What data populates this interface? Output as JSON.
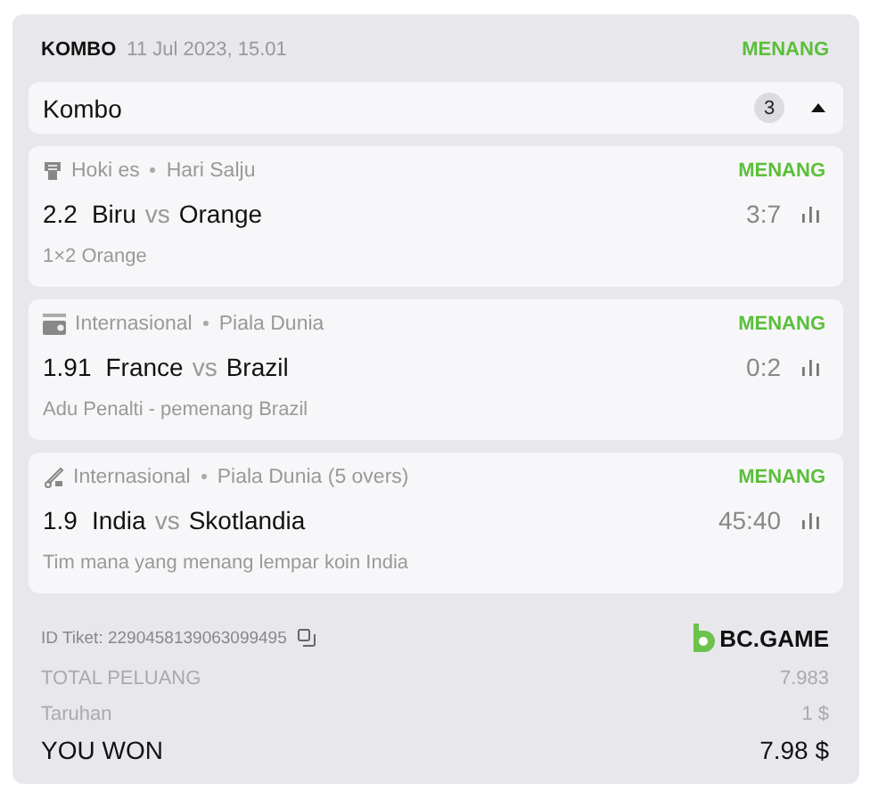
{
  "header": {
    "type": "KOMBO",
    "date": "11 Jul 2023, 15.01",
    "status": "MENANG"
  },
  "combo": {
    "label": "Kombo",
    "count": "3",
    "expanded": true
  },
  "bets": [
    {
      "kind": "hockey",
      "league": "Hoki es",
      "event": "Hari Salju",
      "status": "MENANG",
      "odds": "2.2",
      "home": "Biru",
      "vs": "vs",
      "away": "Orange",
      "score": "3:7",
      "market": "1×2 Orange"
    },
    {
      "kind": "fifa",
      "league": "Internasional",
      "event": "Piala Dunia",
      "status": "MENANG",
      "odds": "1.91",
      "home": "France",
      "vs": "vs",
      "away": "Brazil",
      "score": "0:2",
      "market": "Adu Penalti - pemenang Brazil"
    },
    {
      "kind": "cricket",
      "league": "Internasional",
      "event": "Piala Dunia (5 overs)",
      "status": "MENANG",
      "odds": "1.9",
      "home": "India",
      "vs": "vs",
      "away": "Skotlandia",
      "score": "45:40",
      "market": "Tim mana yang menang lempar koin India"
    }
  ],
  "ticket": {
    "label": "ID Tiket: 2290458139063099495",
    "logo": "BC.GAME"
  },
  "summary": [
    {
      "kind": "muted",
      "label": "TOTAL PELUANG",
      "value": "7.983"
    },
    {
      "kind": "muted",
      "label": "Taruhan",
      "value": "1 $"
    },
    {
      "kind": "total",
      "label": "YOU WON",
      "value": "7.98 $"
    }
  ]
}
